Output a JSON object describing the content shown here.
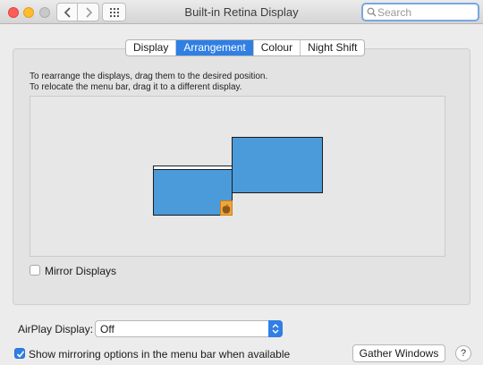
{
  "window": {
    "title": "Built-in Retina Display",
    "search_placeholder": "Search",
    "search_value": ""
  },
  "tabs": [
    {
      "label": "Display",
      "active": false
    },
    {
      "label": "Arrangement",
      "active": true
    },
    {
      "label": "Colour",
      "active": false
    },
    {
      "label": "Night Shift",
      "active": false
    }
  ],
  "arrangement": {
    "instruction_line1": "To rearrange the displays, drag them to the desired position.",
    "instruction_line2": "To relocate the menu bar, drag it to a different display.",
    "mirror_label": "Mirror Displays",
    "mirror_checked": false
  },
  "footer": {
    "airplay_label": "AirPlay Display:",
    "airplay_value": "Off",
    "show_mirroring_label": "Show mirroring options in the menu bar when available",
    "show_mirroring_checked": true,
    "gather_label": "Gather Windows",
    "help_label": "?"
  },
  "colors": {
    "accent": "#2f7fe4",
    "display_fill": "#4b9ad9",
    "active_display_badge": "#f3a43b"
  },
  "icons": [
    "back-chevron-icon",
    "forward-chevron-icon",
    "grid-icon",
    "search-icon",
    "apple-logo-icon",
    "checkmark-icon",
    "updown-arrows-icon"
  ]
}
